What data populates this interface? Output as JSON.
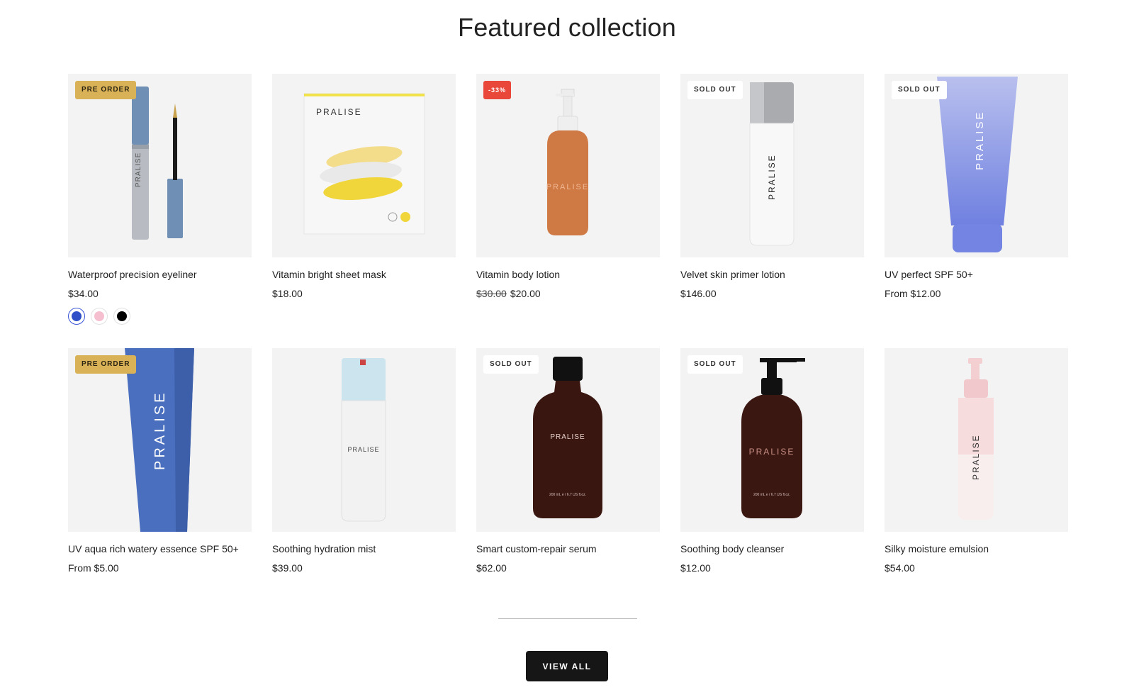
{
  "section": {
    "title": "Featured collection"
  },
  "products": [
    {
      "title": "Waterproof precision eyeliner",
      "price": "$34.00",
      "badge": "PRE ORDER",
      "swatches": [
        "#2f4fc9",
        "#f6bfd0",
        "#000000"
      ]
    },
    {
      "title": "Vitamin bright sheet mask",
      "price": "$18.00",
      "badge": ""
    },
    {
      "title": "Vitamin body lotion",
      "price_old": "$30.00",
      "price": "$20.00",
      "badge": "-33%"
    },
    {
      "title": "Velvet skin primer lotion",
      "price": "$146.00",
      "badge": "SOLD OUT"
    },
    {
      "title": "UV perfect SPF 50+",
      "price": "From $12.00",
      "badge": "SOLD OUT"
    },
    {
      "title": "UV aqua rich watery essence SPF 50+",
      "price": "From $5.00",
      "badge": "PRE ORDER"
    },
    {
      "title": "Soothing hydration mist",
      "price": "$39.00",
      "badge": ""
    },
    {
      "title": "Smart custom-repair serum",
      "price": "$62.00",
      "badge": "SOLD OUT"
    },
    {
      "title": "Soothing body cleanser",
      "price": "$12.00",
      "badge": "SOLD OUT"
    },
    {
      "title": "Silky moisture emulsion",
      "price": "$54.00",
      "badge": ""
    }
  ],
  "brand": {
    "name": "PRALISE",
    "bottle_volume": "200 mL e / 6.7 US fl.oz."
  },
  "colors": {
    "pre_order": "#d9b258",
    "sale": "#e8473a",
    "button": "#161616",
    "card_bg": "#f3f3f3"
  },
  "footer": {
    "view_all_label": "VIEW ALL"
  }
}
